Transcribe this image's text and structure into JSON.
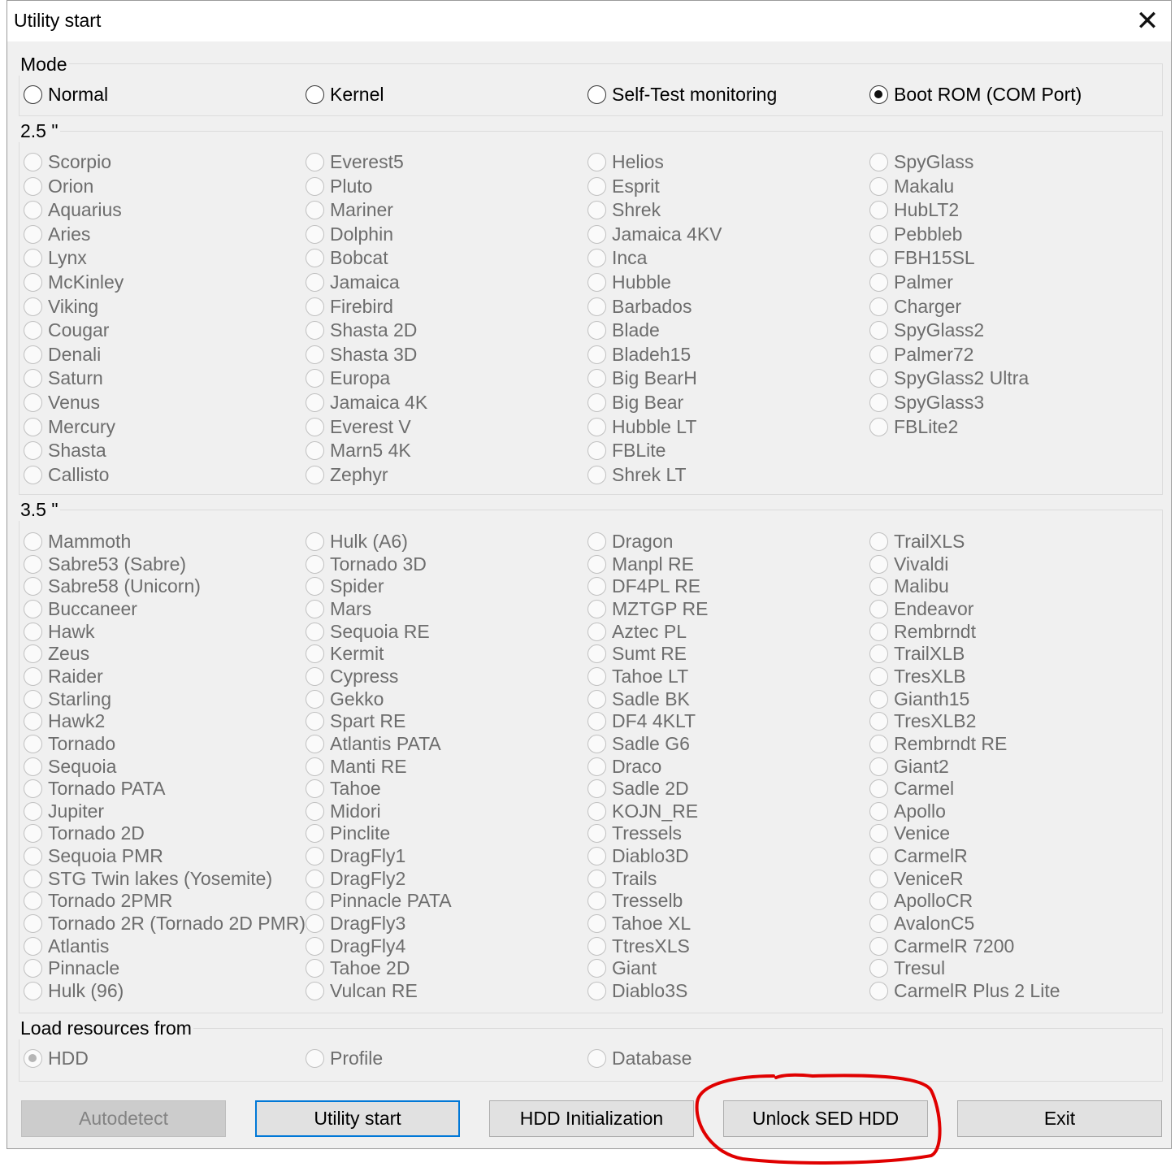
{
  "window": {
    "title": "Utility start",
    "close_icon": "close-icon"
  },
  "mode": {
    "label": "Mode",
    "options": [
      {
        "label": "Normal",
        "checked": false
      },
      {
        "label": "Kernel",
        "checked": false
      },
      {
        "label": "Self-Test monitoring",
        "checked": false
      },
      {
        "label": "Boot ROM (COM Port)",
        "checked": true
      }
    ]
  },
  "group25": {
    "label": "2.5 \"",
    "columns": [
      [
        "Scorpio",
        "Orion",
        "Aquarius",
        "Aries",
        "Lynx",
        "McKinley",
        "Viking",
        "Cougar",
        "Denali",
        "Saturn",
        "Venus",
        "Mercury",
        "Shasta",
        "Callisto"
      ],
      [
        "Everest5",
        "Pluto",
        "Mariner",
        "Dolphin",
        "Bobcat",
        "Jamaica",
        "Firebird",
        "Shasta 2D",
        "Shasta 3D",
        "Europa",
        "Jamaica 4K",
        "Everest V",
        "Marn5 4K",
        "Zephyr"
      ],
      [
        "Helios",
        "Esprit",
        "Shrek",
        "Jamaica 4KV",
        "Inca",
        "Hubble",
        "Barbados",
        "Blade",
        "Bladeh15",
        "Big BearH",
        "Big Bear",
        "Hubble LT",
        "FBLite",
        "Shrek LT"
      ],
      [
        "SpyGlass",
        "Makalu",
        "HubLT2",
        "Pebbleb",
        "FBH15SL",
        "Palmer",
        "Charger",
        "SpyGlass2",
        "Palmer72",
        "SpyGlass2 Ultra",
        "SpyGlass3",
        "FBLite2"
      ]
    ]
  },
  "group35": {
    "label": "3.5 \"",
    "columns": [
      [
        "Mammoth",
        "Sabre53 (Sabre)",
        "Sabre58 (Unicorn)",
        "Buccaneer",
        "Hawk",
        "Zeus",
        "Raider",
        "Starling",
        "Hawk2",
        "Tornado",
        "Sequoia",
        "Tornado PATA",
        "Jupiter",
        "Tornado 2D",
        "Sequoia PMR",
        "STG Twin lakes (Yosemite)",
        "Tornado 2PMR",
        "Tornado 2R (Tornado 2D PMR)",
        "Atlantis",
        "Pinnacle",
        "Hulk (96)"
      ],
      [
        "Hulk (A6)",
        "Tornado 3D",
        "Spider",
        "Mars",
        "Sequoia RE",
        "Kermit",
        "Cypress",
        "Gekko",
        "Spart RE",
        "Atlantis PATA",
        "Manti RE",
        "Tahoe",
        "Midori",
        "Pinclite",
        "DragFly1",
        "DragFly2",
        "Pinnacle PATA",
        "DragFly3",
        "DragFly4",
        "Tahoe 2D",
        "Vulcan RE"
      ],
      [
        "Dragon",
        "Manpl RE",
        "DF4PL RE",
        "MZTGP RE",
        "Aztec PL",
        "Sumt RE",
        "Tahoe LT",
        "Sadle BK",
        "DF4 4KLT",
        "Sadle G6",
        "Draco",
        "Sadle 2D",
        "KOJN_RE",
        "Tressels",
        "Diablo3D",
        "Trails",
        "Tresselb",
        "Tahoe XL",
        "TtresXLS",
        "Giant",
        "Diablo3S"
      ],
      [
        "TrailXLS",
        "Vivaldi",
        "Malibu",
        "Endeavor",
        "Rembrndt",
        "TrailXLB",
        "TresXLB",
        "Gianth15",
        "TresXLB2",
        "Rembrndt RE",
        "Giant2",
        "Carmel",
        "Apollo",
        "Venice",
        "CarmelR",
        "VeniceR",
        "ApolloCR",
        "AvalonC5",
        "CarmelR 7200",
        "Tresul",
        "CarmelR Plus 2 Lite"
      ]
    ]
  },
  "resources": {
    "label": "Load resources from",
    "options": [
      {
        "label": "HDD",
        "checked": true
      },
      {
        "label": "Profile",
        "checked": false
      },
      {
        "label": "Database",
        "checked": false
      }
    ]
  },
  "buttons": {
    "autodetect": "Autodetect",
    "utility_start": "Utility start",
    "hdd_init": "HDD Initialization",
    "unlock_sed": "Unlock SED HDD",
    "exit": "Exit"
  },
  "colors": {
    "accent": "#0078d7",
    "annotation": "#e00000",
    "window_bg": "#f0f0f0"
  }
}
